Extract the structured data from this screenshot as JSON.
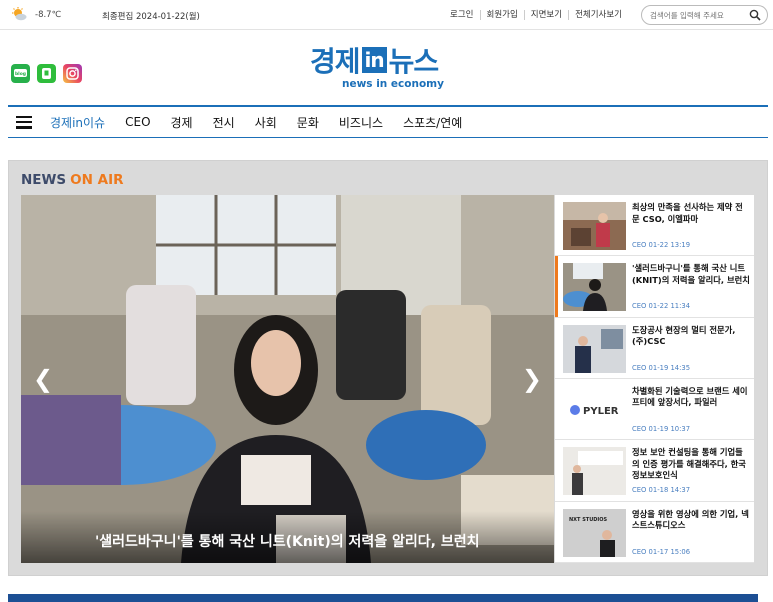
{
  "topbar": {
    "weather_icon": "sun-cloud-icon",
    "temperature": "-8.7℃",
    "updated": "최종편집 2024-01-22(월)",
    "links": [
      "로그인",
      "회원가입",
      "지면보기",
      "전체기사보기"
    ],
    "search_placeholder": "검색어를 입력해 주세요"
  },
  "social": [
    "blog-icon",
    "band-icon",
    "instagram-icon"
  ],
  "logo": {
    "part1": "경제",
    "part2": "in",
    "part3": "뉴스",
    "tagline": "news in economy"
  },
  "nav": {
    "items": [
      "경제in이슈",
      "CEO",
      "경제",
      "전시",
      "사회",
      "문화",
      "비즈니스",
      "스포츠/연예"
    ]
  },
  "onair": {
    "title_news": "NEWS",
    "title_onair": "ON AIR",
    "hero_caption": "'샐러드바구니'를 통해 국산 니트(Knit)의 저력을 알리다, 브런치",
    "arrow_left": "❮",
    "arrow_right": "❯",
    "items": [
      {
        "title": "최상의 만족을 선사하는 제약 전문 CSO, 이엘파마",
        "meta": "CEO 01-22 13:19"
      },
      {
        "title": "'샐러드바구니'를 통해 국산 니트(KNIT)의 저력을 알리다, 브런치",
        "meta": "CEO 01-22 11:34"
      },
      {
        "title": "도장공사 현장의 멀티 전문가, (주)CSC",
        "meta": "CEO 01-19 14:35"
      },
      {
        "title": "차별화된 기술력으로 브랜드 세이프티에 앞장서다, 파일러",
        "meta": "CEO 01-19 10:37"
      },
      {
        "title": "정보 보안 컨설팅을 통해 기업들의 인증 평가를 해결해주다, 한국정보보호인식",
        "meta": "CEO 01-18 14:37"
      },
      {
        "title": "영상을 위한 영상에 의한 기업, 넥스트스튜디오스",
        "meta": "CEO 01-17 15:06"
      }
    ],
    "thumb_text": {
      "pyler": "PYLER",
      "nxt": "NXT STUDIOS"
    }
  },
  "colors": {
    "brand": "#1b6fb8",
    "accent": "#ee7a1e",
    "meta": "#4a7fc0"
  }
}
